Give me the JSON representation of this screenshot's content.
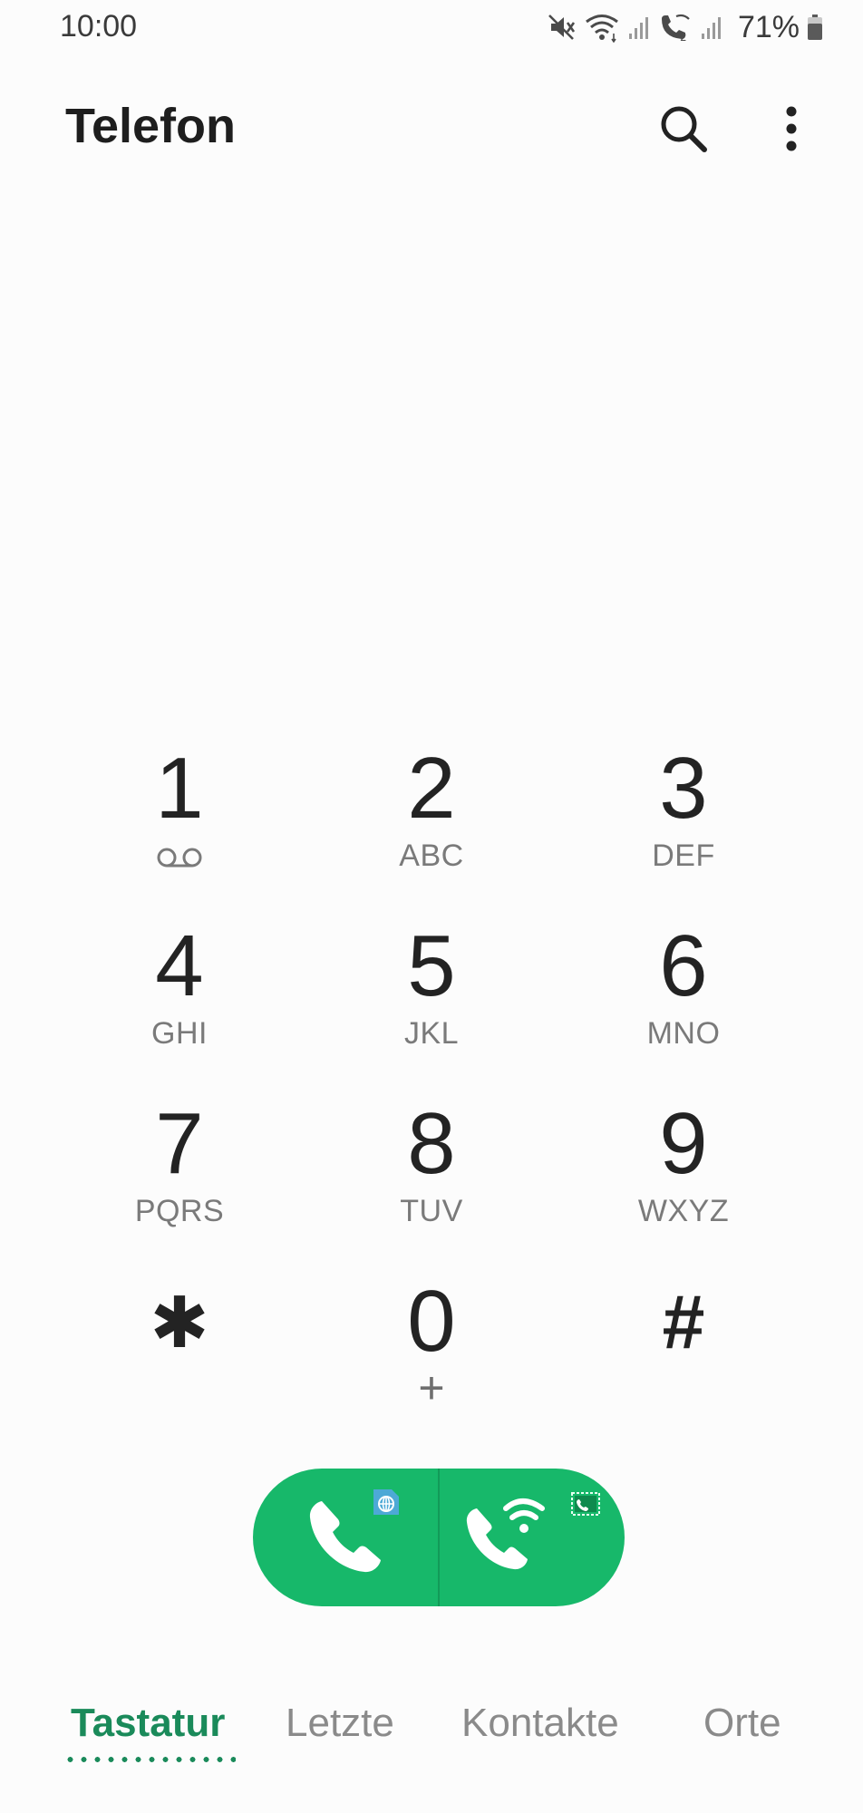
{
  "status_bar": {
    "time": "10:00",
    "battery_percent": "71%",
    "icons": [
      "mute-icon",
      "wifi-icon",
      "signal-icon",
      "wifi-calling-icon",
      "signal-icon",
      "battery-icon"
    ]
  },
  "app_bar": {
    "title": "Telefon",
    "icons": [
      "search-icon",
      "more-vert-icon"
    ]
  },
  "dialpad": {
    "keys": [
      {
        "digit": "1",
        "letters": "",
        "sub_icon": "voicemail-icon"
      },
      {
        "digit": "2",
        "letters": "ABC"
      },
      {
        "digit": "3",
        "letters": "DEF"
      },
      {
        "digit": "4",
        "letters": "GHI"
      },
      {
        "digit": "5",
        "letters": "JKL"
      },
      {
        "digit": "6",
        "letters": "MNO"
      },
      {
        "digit": "7",
        "letters": "PQRS"
      },
      {
        "digit": "8",
        "letters": "TUV"
      },
      {
        "digit": "9",
        "letters": "WXYZ"
      },
      {
        "digit": "✱",
        "letters": ""
      },
      {
        "digit": "0",
        "letters": "+"
      },
      {
        "digit": "#",
        "letters": ""
      }
    ]
  },
  "call_buttons": {
    "color": "#17b86a",
    "buttons": [
      {
        "icon": "phone-icon",
        "badge": "sim-globe-icon"
      },
      {
        "icon": "wifi-phone-icon",
        "badge": "wifi-calling-badge-icon"
      }
    ]
  },
  "tabs": {
    "active_color": "#1a8a5a",
    "items": [
      {
        "label": "Tastatur",
        "active": true
      },
      {
        "label": "Letzte",
        "active": false
      },
      {
        "label": "Kontakte",
        "active": false
      },
      {
        "label": "Orte",
        "active": false
      }
    ]
  }
}
